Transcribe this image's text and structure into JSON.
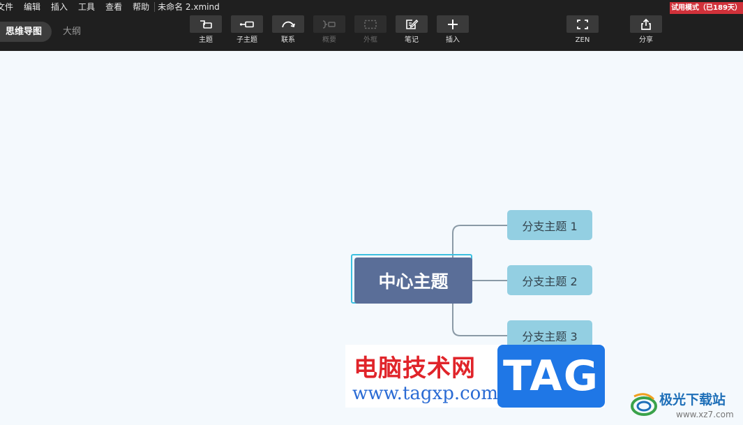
{
  "menubar": {
    "items": [
      "文件",
      "编辑",
      "插入",
      "工具",
      "查看",
      "帮助"
    ],
    "document_title": "未命名 2.xmind"
  },
  "trial_badge": "试用模式（已189天）",
  "view_tabs": {
    "active": "思维导图",
    "inactive": "大纲"
  },
  "toolbar": {
    "topic": "主题",
    "subtopic": "子主题",
    "relationship": "联系",
    "summary": "概要",
    "boundary": "外框",
    "note": "笔记",
    "insert": "插入",
    "zen": "ZEN",
    "share": "分享"
  },
  "mindmap": {
    "central_topic": "中心主题",
    "branches": [
      "分支主题 1",
      "分支主题 2",
      "分支主题 3"
    ]
  },
  "watermark": {
    "site_name": "电脑技术网",
    "site_url": "www.tagxp.com",
    "tag": "TAG",
    "download_site": "极光下载站",
    "download_url": "www.xz7.com"
  },
  "colors": {
    "toolbar_bg": "#1f1f1f",
    "canvas_bg": "#f4f9fd",
    "central_topic": "#5a6e98",
    "branch_topic": "#93cfe2",
    "connector": "#8a9aa6",
    "selection": "#3cc0e0",
    "trial_badge": "#d0313a"
  }
}
